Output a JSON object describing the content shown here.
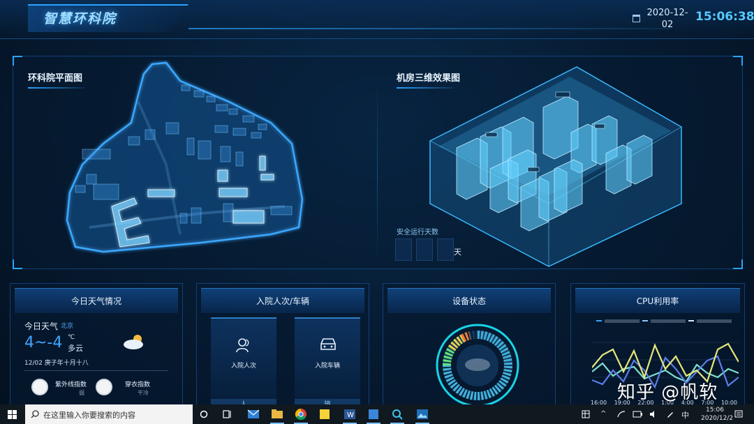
{
  "header": {
    "title": "智慧环科院",
    "date": "2020-12-02",
    "time": "15:06:38",
    "icons": {
      "calendar": "calendar-icon"
    }
  },
  "top_panel": {
    "left_title": "环科院平面图",
    "right_title": "机房三维效果图",
    "safety": {
      "label": "安全运行天数",
      "unit": "天"
    }
  },
  "cards": [
    {
      "title": "今日天气情况",
      "today_label": "今日天气",
      "city": "北京",
      "temp_range": "4~-4",
      "temp_unit": "℃",
      "condition": "多云",
      "date_line": "12/02 庚子年十月十八",
      "indices": [
        {
          "name": "紫外线指数",
          "value": "弱",
          "icon": "uv-index-icon"
        },
        {
          "name": "穿衣指数",
          "value": "干冷",
          "icon": "clothing-index-icon"
        }
      ]
    },
    {
      "title": "入院人次/车辆",
      "items": [
        {
          "label": "入院人次",
          "bottom": "人",
          "icon": "people-icon"
        },
        {
          "label": "入院车辆",
          "bottom": "辆",
          "icon": "car-icon"
        }
      ]
    },
    {
      "title": "设备状态"
    },
    {
      "title": "CPU利用率",
      "x_ticks": [
        "16:00",
        "19:00",
        "22:00",
        "1:00",
        "4:00",
        "7:00",
        "10:00"
      ]
    }
  ],
  "watermark": "知乎 @帆软",
  "taskbar": {
    "search_placeholder": "在这里输入你要搜索的内容",
    "ime": "中",
    "time": "15:06",
    "date": "2020/12/2"
  },
  "colors": {
    "accent": "#2aa3ff",
    "time": "#56c8ff",
    "temp": "#3fa6ff"
  }
}
